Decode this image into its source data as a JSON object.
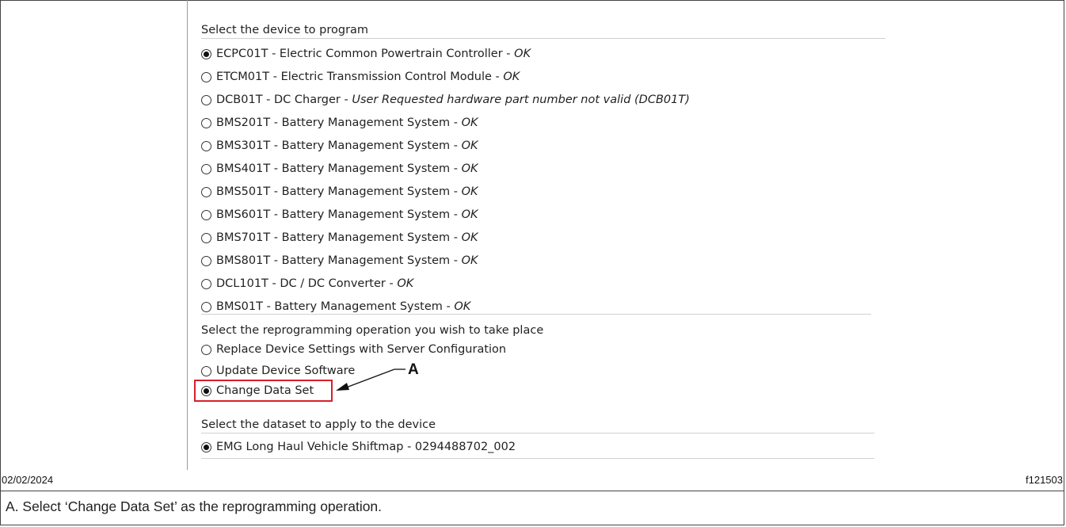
{
  "device_section": {
    "header": "Select the device to program",
    "options": [
      {
        "label": "ECPC01T - Electric Common Powertrain Controller - ",
        "status": "OK",
        "selected": true
      },
      {
        "label": "ETCM01T - Electric Transmission Control Module - ",
        "status": "OK",
        "selected": false
      },
      {
        "label": "DCB01T - DC Charger - ",
        "status": "User Requested hardware part number not valid (DCB01T)",
        "selected": false
      },
      {
        "label": "BMS201T - Battery Management System - ",
        "status": "OK",
        "selected": false
      },
      {
        "label": "BMS301T - Battery Management System - ",
        "status": "OK",
        "selected": false
      },
      {
        "label": "BMS401T - Battery Management System - ",
        "status": "OK",
        "selected": false
      },
      {
        "label": "BMS501T - Battery Management System - ",
        "status": "OK",
        "selected": false
      },
      {
        "label": "BMS601T - Battery Management System - ",
        "status": "OK",
        "selected": false
      },
      {
        "label": "BMS701T - Battery Management System - ",
        "status": "OK",
        "selected": false
      },
      {
        "label": "BMS801T - Battery Management System - ",
        "status": "OK",
        "selected": false
      },
      {
        "label": "DCL101T - DC / DC Converter - ",
        "status": "OK",
        "selected": false
      },
      {
        "label": "BMS01T - Battery Management System - ",
        "status": "OK",
        "selected": false
      }
    ]
  },
  "operation_section": {
    "header": "Select the reprogramming operation you wish to take place",
    "options": [
      {
        "label": "Replace Device Settings with Server Configuration",
        "selected": false
      },
      {
        "label": "Update Device Software",
        "selected": false
      },
      {
        "label": "Change Data Set",
        "selected": true
      }
    ]
  },
  "dataset_section": {
    "header": "Select the dataset to apply to the device",
    "options": [
      {
        "label": "EMG Long Haul Vehicle Shiftmap - 0294488702_002",
        "selected": true
      }
    ]
  },
  "callout": {
    "letter": "A"
  },
  "footer": {
    "date": "02/02/2024",
    "figure_id": "f121503",
    "caption": "A. Select ‘Change Data Set’ as the reprogramming operation."
  },
  "colors": {
    "highlight": "#d6202a"
  }
}
